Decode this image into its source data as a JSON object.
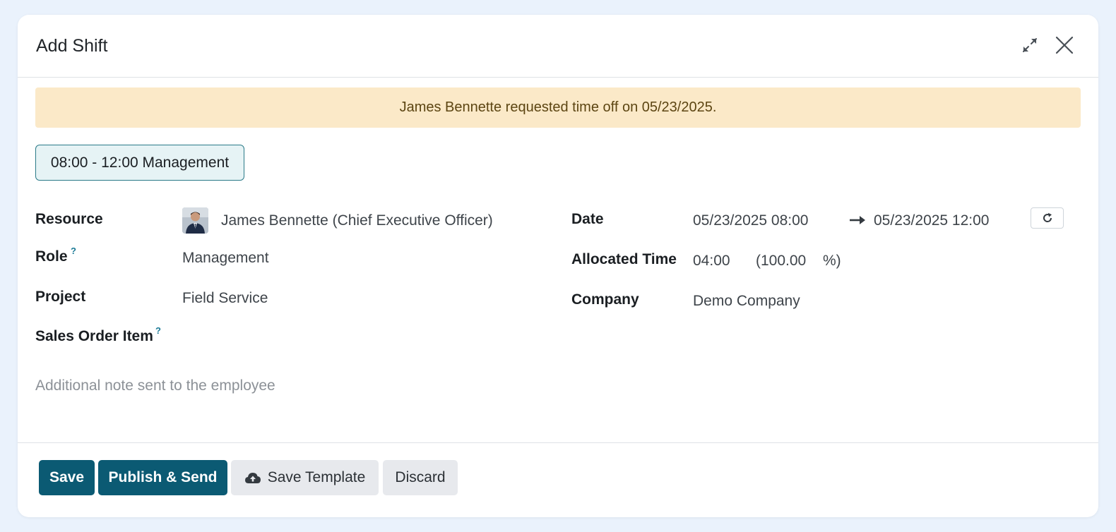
{
  "dialog": {
    "title": "Add Shift"
  },
  "alert": {
    "text": "James Bennette requested time off on 05/23/2025."
  },
  "shift_template": {
    "label": "08:00 - 12:00 Management"
  },
  "fields": {
    "resource": {
      "label": "Resource",
      "value": "James Bennette (Chief Executive Officer)"
    },
    "role": {
      "label": "Role",
      "help": "?",
      "value": "Management"
    },
    "project": {
      "label": "Project",
      "value": "Field Service"
    },
    "sales_order_item": {
      "label": "Sales Order Item",
      "help": "?",
      "value": ""
    },
    "date": {
      "label": "Date",
      "start": "05/23/2025 08:00",
      "end": "05/23/2025 12:00"
    },
    "allocated_time": {
      "label": "Allocated Time",
      "hours": "04:00",
      "percent_open": "(100.00",
      "percent_close": "%)"
    },
    "company": {
      "label": "Company",
      "value": "Demo Company"
    }
  },
  "note": {
    "placeholder": "Additional note sent to the employee"
  },
  "footer": {
    "save_label": "Save",
    "publish_label": "Publish & Send",
    "template_label": "Save Template",
    "discard_label": "Discard"
  },
  "icons": {
    "expand": "expand-icon",
    "close": "close-icon",
    "arrow": "arrow-right-icon",
    "refresh": "refresh-icon",
    "upload": "cloud-upload-icon"
  },
  "colors": {
    "primary": "#0b5a73",
    "alert_bg": "#fbe9c8",
    "alert_text": "#5c4512",
    "template_border": "#2a7a88",
    "help": "#1b7a96"
  }
}
